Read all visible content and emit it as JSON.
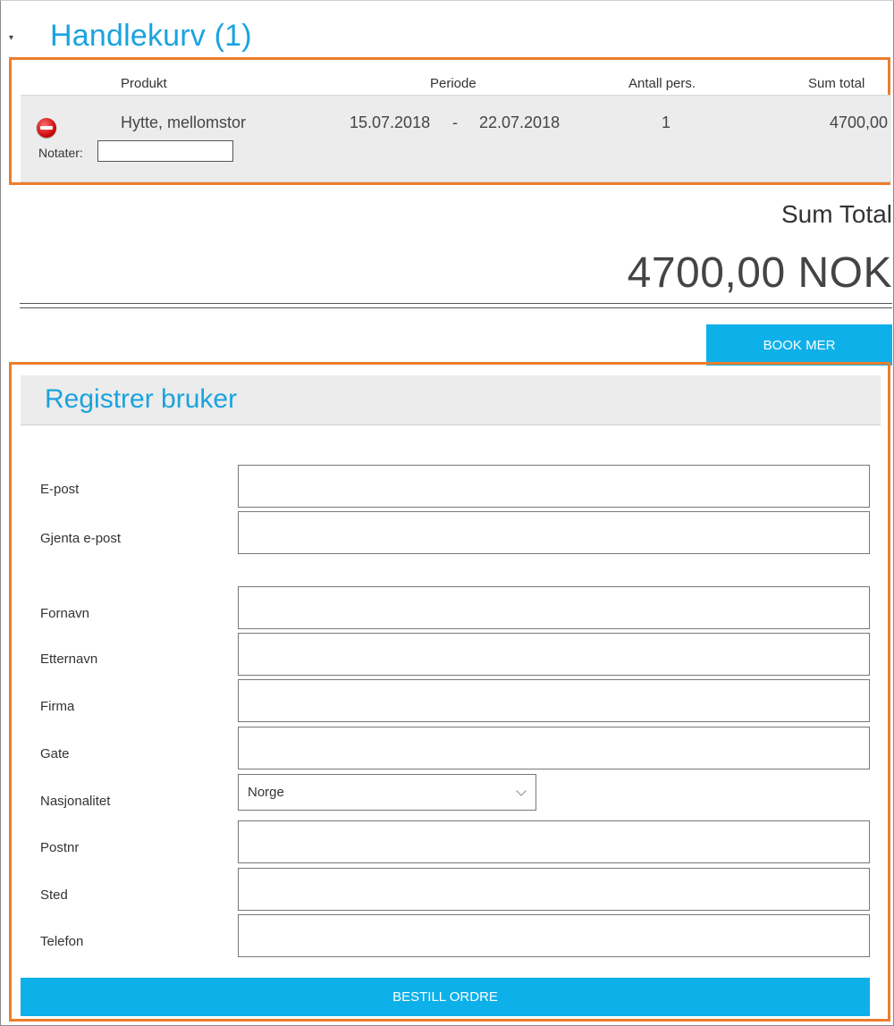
{
  "cart": {
    "title": "Handlekurv (1)",
    "columns": {
      "product": "Produkt",
      "period": "Periode",
      "persons": "Antall pers.",
      "sum": "Sum total"
    },
    "row": {
      "product": "Hytte, mellomstor",
      "date_from": "15.07.2018",
      "date_separator": "-",
      "date_to": "22.07.2018",
      "persons": "1",
      "sum": "4700,00",
      "notes_label": "Notater:",
      "notes_value": ""
    }
  },
  "summary": {
    "label": "Sum Total",
    "value": "4700,00 NOK"
  },
  "actions": {
    "book_more": "BOOK MER",
    "order": "BESTILL ORDRE"
  },
  "register": {
    "title": "Registrer bruker",
    "fields": {
      "email": "E-post",
      "email_repeat": "Gjenta e-post",
      "first_name": "Fornavn",
      "last_name": "Etternavn",
      "company": "Firma",
      "street": "Gate",
      "nationality": "Nasjonalitet",
      "postcode": "Postnr",
      "city": "Sted",
      "phone": "Telefon"
    },
    "nationality_selected": "Norge"
  },
  "colors": {
    "accent": "#0eb0ea",
    "title": "#1aa3df",
    "highlight_border": "#ec7d2c"
  }
}
